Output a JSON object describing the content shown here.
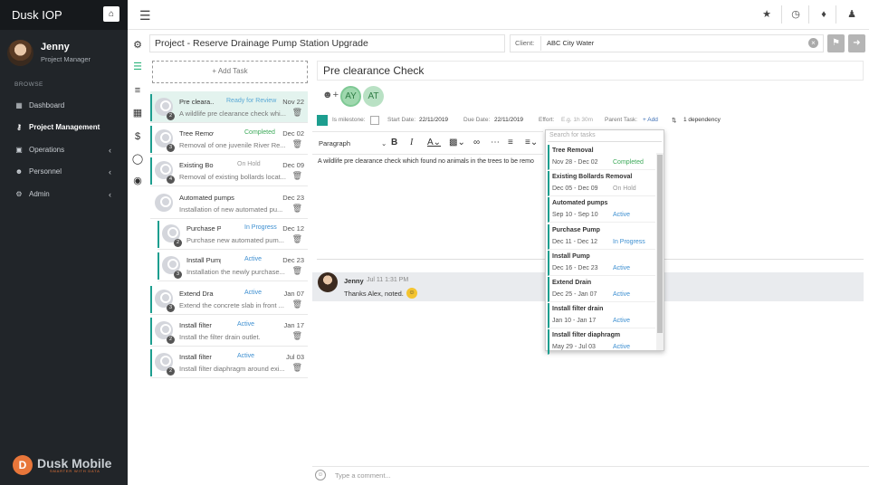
{
  "app": {
    "name": "Dusk IOP"
  },
  "user": {
    "name": "Jenny",
    "role": "Project Manager"
  },
  "sidebar": {
    "section": "BROWSE",
    "items": [
      {
        "label": "Dashboard",
        "icon": "dashboard-icon",
        "active": false,
        "chevron": false
      },
      {
        "label": "Project Management",
        "icon": "sitemap-icon",
        "active": true,
        "chevron": false
      },
      {
        "label": "Operations",
        "icon": "archive-icon",
        "active": false,
        "chevron": true
      },
      {
        "label": "Personnel",
        "icon": "users-icon",
        "active": false,
        "chevron": true
      },
      {
        "label": "Admin",
        "icon": "cogs-icon",
        "active": false,
        "chevron": true
      }
    ]
  },
  "logo": {
    "text": "Dusk Mobile",
    "tagline": "SMARTER WITH DATA"
  },
  "project": {
    "title": "Project - Reserve Drainage Pump Station Upgrade",
    "client_label": "Client:",
    "client_value": "ABC City Water"
  },
  "task_list": {
    "add_label": "+ Add Task",
    "tasks": [
      {
        "name": "Pre cleara...",
        "status": "Ready for Review",
        "status_color": "#5aa9d6",
        "date": "Nov 22",
        "desc": "A wildlife pre clearance check whi...",
        "count": "2",
        "bar": true,
        "selected": true,
        "indent": false
      },
      {
        "name": "Tree Removal",
        "status": "Completed",
        "status_color": "#3daa5a",
        "date": "Dec 02",
        "desc": "Removal of one juvenile River Re...",
        "count": "3",
        "bar": true,
        "selected": false,
        "indent": false
      },
      {
        "name": "Existing Bollards ...",
        "status": "On Hold",
        "status_color": "#999999",
        "date": "Dec 09",
        "desc": "Removal of existing bollards locat...",
        "count": "4",
        "bar": true,
        "selected": false,
        "indent": false
      },
      {
        "name": "Automated pumps",
        "status": "",
        "status_color": "#999999",
        "date": "Dec 23",
        "desc": "Installation of new automated pu...",
        "count": "",
        "bar": false,
        "selected": false,
        "indent": false
      },
      {
        "name": "Purchase Pump",
        "status": "In Progress",
        "status_color": "#3d8fd1",
        "date": "Dec 12",
        "desc": "Purchase new automated pum...",
        "count": "2",
        "bar": true,
        "selected": false,
        "indent": true
      },
      {
        "name": "Install Pump",
        "status": "Active",
        "status_color": "#3d8fd1",
        "date": "Dec 23",
        "desc": "Installation the newly purchase...",
        "count": "3",
        "bar": true,
        "selected": false,
        "indent": true
      },
      {
        "name": "Extend Drain",
        "status": "Active",
        "status_color": "#3d8fd1",
        "date": "Jan 07",
        "desc": "Extend the concrete slab in front ...",
        "count": "3",
        "bar": true,
        "selected": false,
        "indent": false
      },
      {
        "name": "Install filter drain",
        "status": "Active",
        "status_color": "#3d8fd1",
        "date": "Jan 17",
        "desc": "Install the filter drain outlet.",
        "count": "2",
        "bar": true,
        "selected": false,
        "indent": false
      },
      {
        "name": "Install filter diaphr...",
        "status": "Active",
        "status_color": "#3d8fd1",
        "date": "Jul 03",
        "desc": "Install filter diaphragm around exi...",
        "count": "2",
        "bar": true,
        "selected": false,
        "indent": false
      }
    ]
  },
  "detail": {
    "title": "Pre clearance Check",
    "assignees": [
      "AY",
      "AT"
    ],
    "milestone_label": "Is milestone:",
    "start_label": "Start Date:",
    "start_value": "22/11/2019",
    "due_label": "Due Date:",
    "due_value": "22/11/2019",
    "effort_label": "Effort:",
    "effort_placeholder": "E.g. 1h 30m",
    "parent_label": "Parent Task:",
    "parent_add": "+ Add",
    "dependency": "1 dependency",
    "format_select": "Paragraph",
    "description": "A wildlife pre clearance check which found no animals in the trees to be remo"
  },
  "comment": {
    "author": "Jenny",
    "time": "Jul 11 1:31 PM",
    "text": "Thanks Alex, noted.",
    "placeholder": "Type a comment..."
  },
  "dependency_dropdown": {
    "search_placeholder": "Search for tasks",
    "items": [
      {
        "name": "Tree Removal",
        "range": "Nov 28 - Dec 02",
        "status": "Completed",
        "status_color": "#3daa5a"
      },
      {
        "name": "Existing Bollards Removal",
        "range": "Dec 05 - Dec 09",
        "status": "On Hold",
        "status_color": "#999999"
      },
      {
        "name": "Automated pumps",
        "range": "Sep 10 - Sep 10",
        "status": "Active",
        "status_color": "#3d8fd1"
      },
      {
        "name": "Purchase Pump",
        "range": "Dec 11 - Dec 12",
        "status": "In Progress",
        "status_color": "#3d8fd1"
      },
      {
        "name": "Install Pump",
        "range": "Dec 16 - Dec 23",
        "status": "Active",
        "status_color": "#3d8fd1"
      },
      {
        "name": "Extend Drain",
        "range": "Dec 25 - Jan 07",
        "status": "Active",
        "status_color": "#3d8fd1"
      },
      {
        "name": "Install filter drain",
        "range": "Jan 10 - Jan 17",
        "status": "Active",
        "status_color": "#3d8fd1"
      },
      {
        "name": "Install filter diaphragm",
        "range": "May 29 - Jul 03",
        "status": "Active",
        "status_color": "#3d8fd1"
      }
    ]
  },
  "colors": {
    "accent": "#1d9e8f",
    "sidebar": "#212529",
    "brand": "#e8763a"
  }
}
